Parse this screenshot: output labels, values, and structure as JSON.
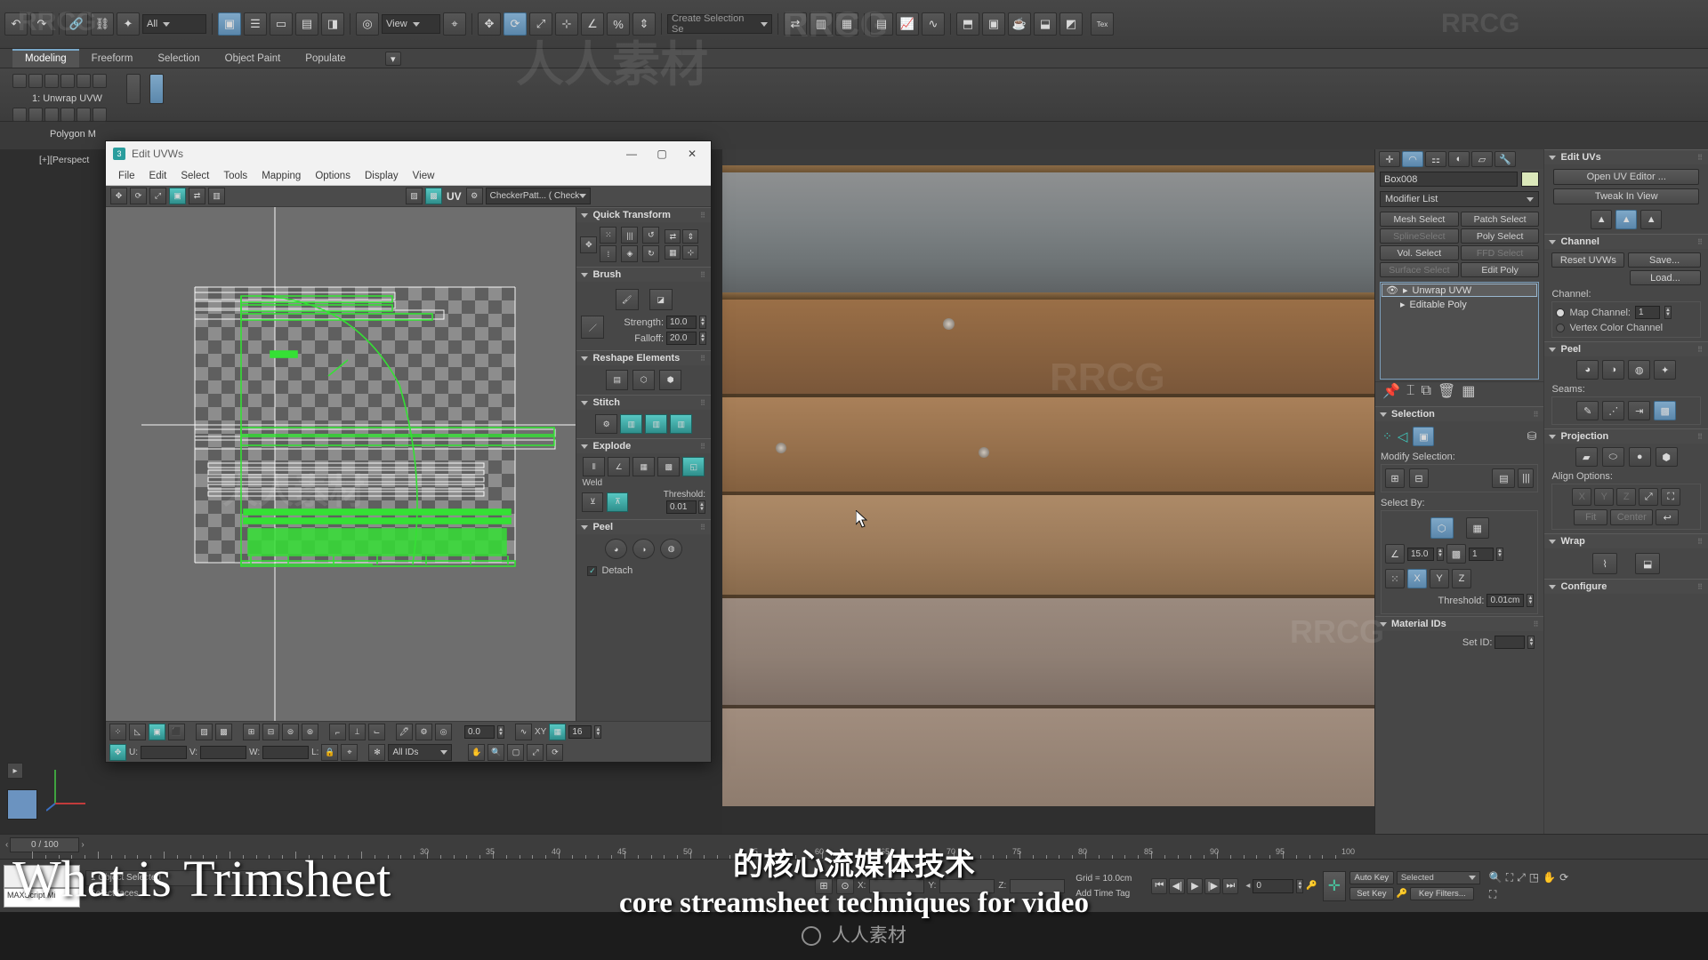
{
  "app": {
    "title": "3ds Max",
    "scene_object": "Box008"
  },
  "topbar": {
    "icons": [
      "undo-icon",
      "redo-icon",
      "link-icon",
      "unlink-icon",
      "bind-space-warp-icon"
    ],
    "selection_filter": "All",
    "view_mode": "View",
    "named_selection_placeholder": "Create Selection Se",
    "tex_label": "Tex"
  },
  "ribbon": {
    "tabs": [
      {
        "label": "Modeling",
        "active": true
      },
      {
        "label": "Freeform",
        "active": false
      },
      {
        "label": "Selection",
        "active": false
      },
      {
        "label": "Object Paint",
        "active": false
      },
      {
        "label": "Populate",
        "active": false
      }
    ],
    "modifier_label": "1: Unwrap UVW",
    "sub_label": "Polygon M"
  },
  "viewport": {
    "label": "[+][Perspect",
    "grid_note": "Grid = 10.0cm"
  },
  "uvw_dialog": {
    "title": "Edit UVWs",
    "menu": [
      "File",
      "Edit",
      "Select",
      "Tools",
      "Mapping",
      "Options",
      "Display",
      "View"
    ],
    "uv_label": "UV",
    "texture_dropdown": "CheckerPatt... ( Checker )",
    "bottom": {
      "u_label": "U:",
      "u_value": "",
      "v_label": "V:",
      "v_value": "",
      "w_label": "W:",
      "w_value": "",
      "l_label": "L:",
      "all_ids": "All IDs",
      "numeric_value": "0.0",
      "xy_label": "XY",
      "grid_value": "16"
    },
    "rollouts": [
      {
        "name": "Quick Transform"
      },
      {
        "name": "Brush",
        "strength_label": "Strength:",
        "strength_value": "10.0",
        "falloff_label": "Falloff:",
        "falloff_value": "20.0"
      },
      {
        "name": "Reshape Elements"
      },
      {
        "name": "Stitch"
      },
      {
        "name": "Explode",
        "weld_label": "Weld",
        "threshold_label": "Threshold:",
        "threshold_value": "0.01"
      },
      {
        "name": "Peel",
        "detach_label": "Detach",
        "detach_checked": true
      }
    ]
  },
  "command_panel": {
    "object_name": "Box008",
    "modifier_list": "Modifier List",
    "modifier_buttons": [
      {
        "label": "Mesh Select",
        "disabled": false
      },
      {
        "label": "Patch Select",
        "disabled": false
      },
      {
        "label": "SplineSelect",
        "disabled": true
      },
      {
        "label": "Poly Select",
        "disabled": false
      },
      {
        "label": "Vol. Select",
        "disabled": false
      },
      {
        "label": "FFD Select",
        "disabled": true
      },
      {
        "label": "Surface Select",
        "disabled": true
      },
      {
        "label": "Edit Poly",
        "disabled": false
      }
    ],
    "stack": [
      {
        "label": "Unwrap UVW",
        "selected": true
      },
      {
        "label": "Editable Poly",
        "selected": false
      }
    ],
    "selection": {
      "title": "Selection",
      "modify_label": "Modify Selection:",
      "select_by_label": "Select By:",
      "angle_value": "15.0",
      "count_value": "1",
      "axes": [
        "X",
        "Y",
        "Z"
      ],
      "threshold_label": "Threshold:",
      "threshold_value": "0.01cm"
    },
    "material_ids": {
      "title": "Material IDs",
      "set_id_label": "Set ID:",
      "set_id_value": ""
    },
    "edit_uvs": {
      "title": "Edit UVs",
      "open_editor": "Open UV Editor ...",
      "tweak_in_view": "Tweak In View"
    },
    "channel": {
      "title": "Channel",
      "reset": "Reset UVWs",
      "save": "Save...",
      "load": "Load...",
      "group_label": "Channel:",
      "map_channel_label": "Map Channel:",
      "map_channel_value": "1",
      "vertex_color_label": "Vertex Color Channel"
    },
    "peel": {
      "title": "Peel",
      "seams_label": "Seams:"
    },
    "projection": {
      "title": "Projection",
      "align_label": "Align Options:",
      "axes": [
        "X",
        "Y",
        "Z"
      ],
      "fit": "Fit",
      "center": "Center"
    },
    "wrap": {
      "title": "Wrap"
    },
    "configure": {
      "title": "Configure"
    }
  },
  "timeline": {
    "frame_counter": "0 / 100",
    "ticks": [
      "30",
      "35",
      "40",
      "45",
      "50",
      "55",
      "60",
      "65",
      "70",
      "75",
      "80",
      "85",
      "90",
      "95",
      "100"
    ]
  },
  "statusbar": {
    "selection_text": "1 Object Selected",
    "prompt": "Select faces",
    "maxscript": "MAXScript Mi",
    "x_label": "X:",
    "y_label": "Y:",
    "z_label": "Z:",
    "grid": "Grid = 10.0cm",
    "add_time_tag": "Add Time Tag",
    "auto_key": "Auto Key",
    "set_key": "Set Key",
    "key_filters": "Key Filters...",
    "selected_dropdown": "Selected",
    "key_frame": "0"
  },
  "overlay": {
    "big_title": "What is Trimsheet",
    "subtitle_cn": "的核心流媒体技术",
    "subtitle_en": "core streamsheet techniques for video",
    "brand": "人人素材",
    "watermark_a": "RRCG",
    "watermark_b": "人人素材"
  },
  "colors": {
    "accent": "#7aa7c7",
    "teal": "#2f8f8c",
    "uv_green": "#35e035",
    "panel": "#474747"
  }
}
